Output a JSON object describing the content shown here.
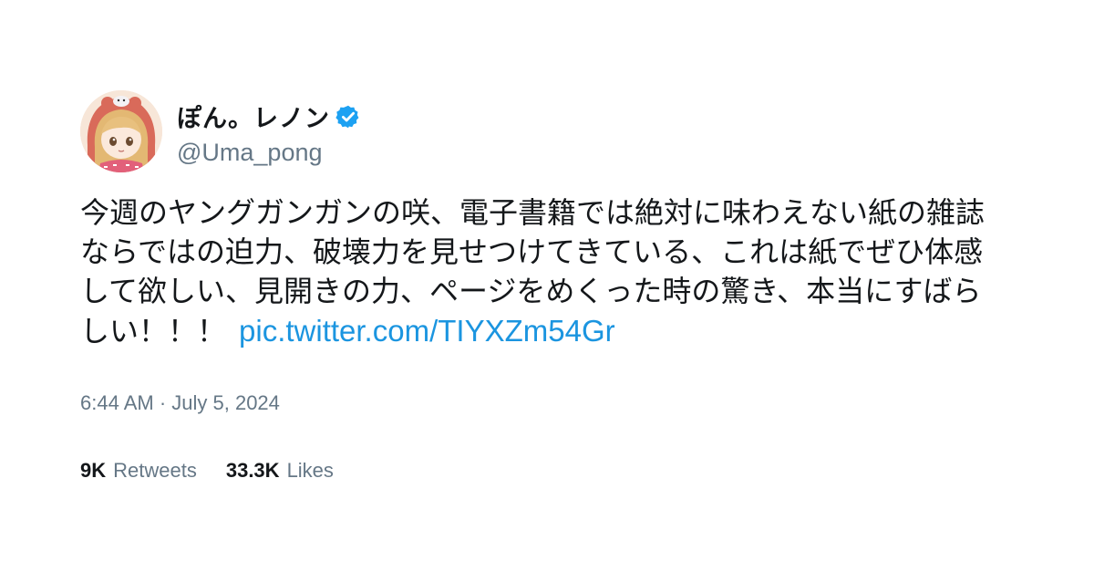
{
  "user": {
    "display_name": "ぽん。レノン",
    "handle": "@Uma_pong",
    "verified_icon": "verified-badge-icon",
    "avatar_icon": "avatar-image"
  },
  "tweet": {
    "text": "今週のヤングガンガンの咲、電子書籍では絶対に味わえない紙の雑誌ならではの迫力、破壊力を見せつけてきている、これは紙でぜひ体感して欲しい、見開きの力、ページをめくった時の驚き、本当にすばらしい！！！",
    "link": "pic.twitter.com/TIYXZm54Gr",
    "timestamp": "6:44 AM · July 5, 2024"
  },
  "stats": {
    "retweets_count": "9K",
    "retweets_label": "Retweets",
    "likes_count": "33.3K",
    "likes_label": "Likes"
  },
  "colors": {
    "link": "#1b95e0",
    "secondary_text": "#657786",
    "primary_text": "#14171a",
    "verified": "#1da1f2"
  }
}
